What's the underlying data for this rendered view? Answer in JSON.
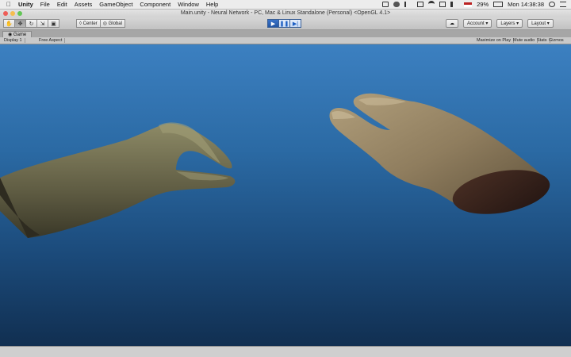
{
  "menubar": {
    "apple": "",
    "items": [
      "Unity",
      "File",
      "Edit",
      "Assets",
      "GameObject",
      "Component",
      "Window",
      "Help"
    ],
    "battery": "29%",
    "clock": "Mon 14:38:38"
  },
  "window": {
    "title": "Main.unity - Neural Network - PC, Mac & Linux Standalone (Personal) <OpenGL 4.1>"
  },
  "toolbar": {
    "pivot_label": "Center",
    "space_label": "Global",
    "account_label": "Account",
    "layers_label": "Layers",
    "layout_label": "Layout"
  },
  "game_tab": {
    "label": "Game",
    "display": "Display 1",
    "aspect": "Free Aspect",
    "maximize": "Maximize on Play",
    "mute": "Mute audio",
    "stats": "Stats",
    "gizmos": "Gizmos"
  },
  "colors": {
    "sky_top": "#3c80c1",
    "sky_bottom": "#112f51",
    "play_active": "#2456a4"
  }
}
